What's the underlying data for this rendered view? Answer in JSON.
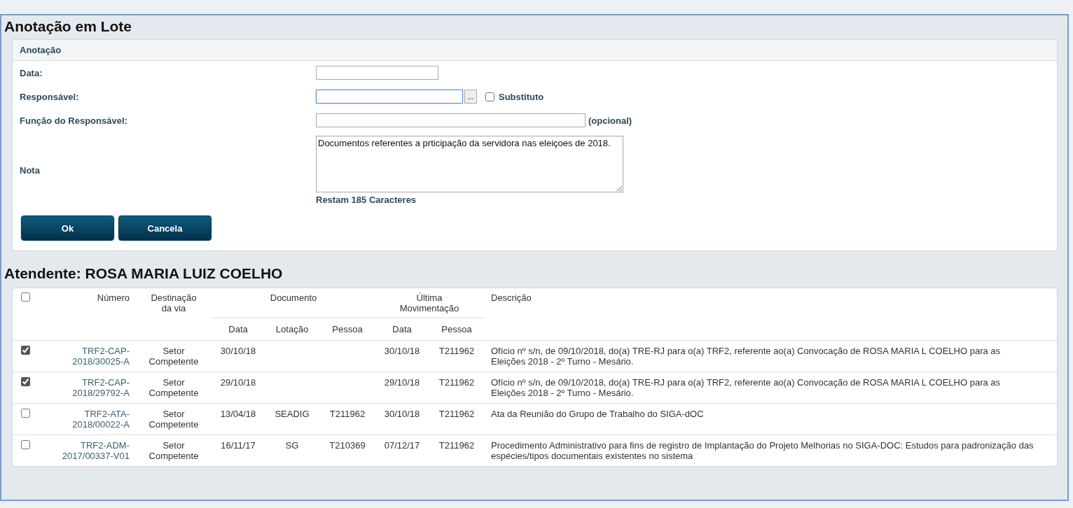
{
  "title": "Anotação em Lote",
  "form": {
    "section_title": "Anotação",
    "fields": [
      {
        "kind": "date",
        "label": "Data:"
      },
      {
        "kind": "person",
        "label": "Responsável:",
        "focused": true,
        "lookup": "...",
        "checkbox_label": "Substituto",
        "checked": false
      },
      {
        "kind": "text",
        "label": "Função do Responsável:",
        "suffix": "(opcional)"
      },
      {
        "kind": "textarea",
        "label": "Nota",
        "value": "Documentos referentes a prticipação da servidora nas eleiçoes de 2018.",
        "counter": "Restam 185 Caracteres"
      }
    ],
    "buttons": [
      "Ok",
      "Cancela"
    ]
  },
  "atendente": "Atendente: ROSA MARIA LUIZ COELHO",
  "table": {
    "select_all_checked": false,
    "columns": [
      {
        "label": "Número"
      },
      {
        "label": "Destinação da via"
      },
      {
        "label": "Documento",
        "children": [
          {
            "label": "Data"
          },
          {
            "label": "Lotação"
          },
          {
            "label": "Pessoa"
          }
        ]
      },
      {
        "label": "Última Movimentação",
        "children": [
          {
            "label": "Data"
          },
          {
            "label": "Pessoa"
          }
        ]
      },
      {
        "label": "Descrição"
      }
    ],
    "rows": [
      {
        "checked": true,
        "numero": "TRF2-CAP-2018/30025-A",
        "destinacao": "Setor Competente",
        "doc_data": "30/10/18",
        "doc_lotacao": "",
        "doc_pessoa": "",
        "mov_data": "30/10/18",
        "mov_pessoa": "T211962",
        "descricao": "Ofício nº s/n, de 09/10/2018, do(a) TRE-RJ para o(a) TRF2, referente ao(a) Convocação de ROSA MARIA L COELHO para as Eleições 2018 - 2º Turno - Mesário."
      },
      {
        "checked": true,
        "numero": "TRF2-CAP-2018/29792-A",
        "destinacao": "Setor Competente",
        "doc_data": "29/10/18",
        "doc_lotacao": "",
        "doc_pessoa": "",
        "mov_data": "29/10/18",
        "mov_pessoa": "T211962",
        "descricao": "Ofício nº s/n, de 09/10/2018, do(a) TRE-RJ para o(a) TRF2, referente ao(a) Convocação de ROSA MARIA L COELHO para as Eleições 2018 - 2º Turno - Mesário."
      },
      {
        "checked": false,
        "numero": "TRF2-ATA-2018/00022-A",
        "destinacao": "Setor Competente",
        "doc_data": "13/04/18",
        "doc_lotacao": "SEADIG",
        "doc_pessoa": "T211962",
        "mov_data": "30/10/18",
        "mov_pessoa": "T211962",
        "descricao": "Ata da Reunião do Grupo de Trabalho do SIGA-dOC"
      },
      {
        "checked": false,
        "numero": "TRF2-ADM-2017/00337-V01",
        "destinacao": "Setor Competente",
        "doc_data": "16/11/17",
        "doc_lotacao": "SG",
        "doc_pessoa": "T210369",
        "mov_data": "07/12/17",
        "mov_pessoa": "T211962",
        "descricao": "Procedimento Administrativo para fins de registro de Implantação do Projeto Melhorias no SIGA-DOC: Estudos para padronização das espécies/tipos documentais existentes no sistema"
      }
    ]
  }
}
